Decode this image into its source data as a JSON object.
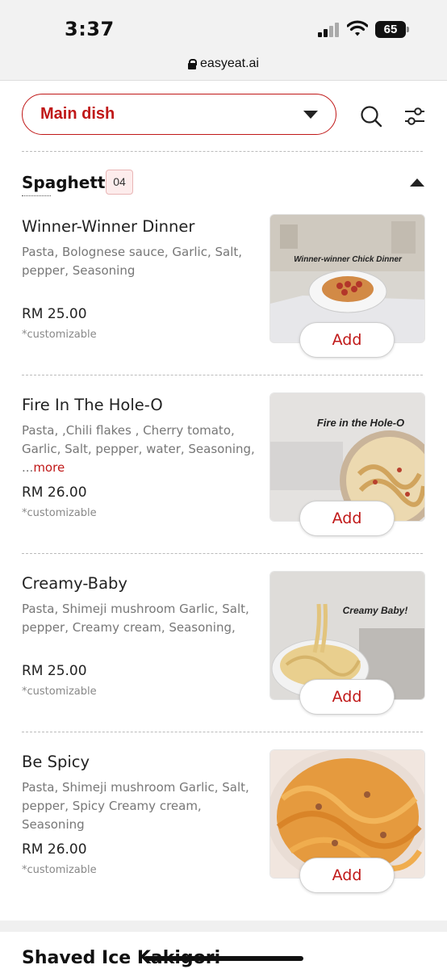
{
  "status_bar": {
    "time": "3:37",
    "battery": "65"
  },
  "browser": {
    "url": "easyeat.ai"
  },
  "category_select": {
    "selected": "Main dish"
  },
  "section": {
    "title": "Spaghetti",
    "count": "04"
  },
  "items": [
    {
      "name": "Winner-Winner Dinner",
      "description": "Pasta, Bolognese sauce, Garlic, Salt, pepper, Seasoning",
      "more": "",
      "price": "RM 25.00",
      "note": "*customizable",
      "photo_caption": "Winner-winner Chick Dinner",
      "add_label": "Add"
    },
    {
      "name": "Fire In The Hole-O",
      "description": "Pasta, ,Chili flakes , Cherry tomato, Garlic, Salt, pepper, water, Seasoning, ...",
      "more": "more",
      "price": "RM 26.00",
      "note": "*customizable",
      "photo_caption": "Fire in the Hole-O",
      "add_label": "Add"
    },
    {
      "name": "Creamy-Baby",
      "description": "Pasta, Shimeji mushroom Garlic, Salt, pepper, Creamy cream, Seasoning,",
      "more": "",
      "price": "RM 25.00",
      "note": "*customizable",
      "photo_caption": "Creamy Baby!",
      "add_label": "Add"
    },
    {
      "name": "Be Spicy",
      "description": "Pasta, Shimeji mushroom Garlic, Salt, pepper, Spicy Creamy cream, Seasoning",
      "more": "",
      "price": "RM 26.00",
      "note": "*customizable",
      "photo_caption": "",
      "add_label": "Add"
    }
  ],
  "next_section": {
    "title": "Shaved Ice Kakigori"
  },
  "colors": {
    "accent": "#c01818",
    "badge_bg": "#fdecec"
  }
}
